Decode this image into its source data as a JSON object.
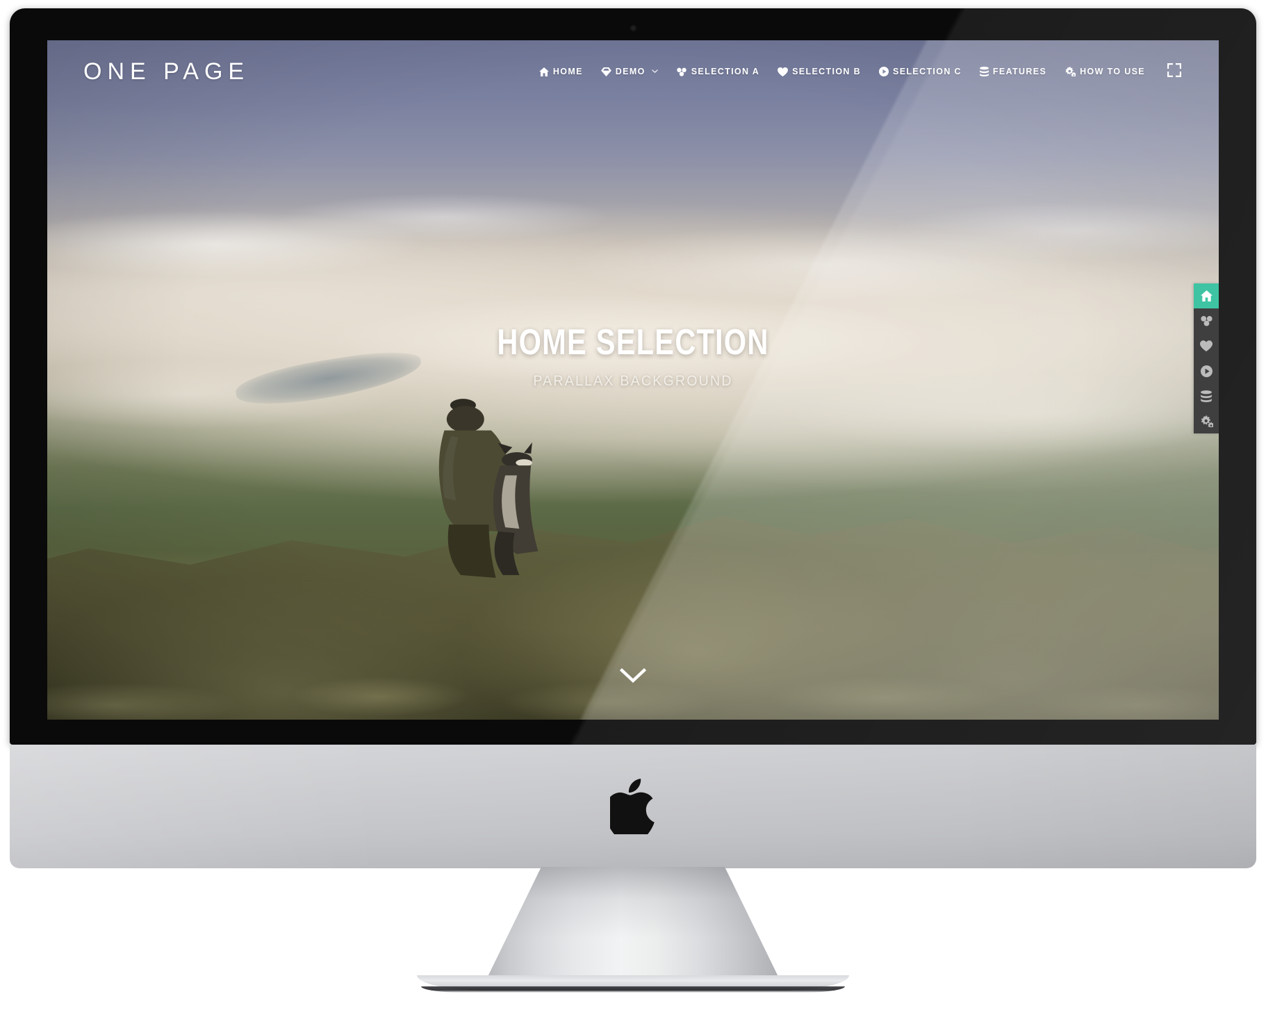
{
  "device": {
    "brand_logo_name": "apple-logo",
    "type": "imac-desktop-mockup"
  },
  "site": {
    "brand": "ONE PAGE",
    "nav": [
      {
        "label": "HOME",
        "icon": "home-icon",
        "has_caret": false
      },
      {
        "label": "DEMO",
        "icon": "gem-icon",
        "has_caret": true
      },
      {
        "label": "SELECTION A",
        "icon": "cubes-icon",
        "has_caret": false
      },
      {
        "label": "SELECTION B",
        "icon": "heart-icon",
        "has_caret": false
      },
      {
        "label": "SELECTION C",
        "icon": "play-circle-icon",
        "has_caret": false
      },
      {
        "label": "FEATURES",
        "icon": "database-icon",
        "has_caret": false
      },
      {
        "label": "HOW TO USE",
        "icon": "gears-icon",
        "has_caret": false
      }
    ],
    "nav_expand_icon": "expand-fullscreen-icon",
    "hero": {
      "title": "HOME SELECTION",
      "subtitle": "PARALLAX BACKGROUND",
      "scroll_hint_icon": "chevron-down-icon"
    },
    "side_dock": {
      "active_index": 0,
      "accent_color": "#2bbe9a",
      "background_color": "#2b2b2b",
      "items": [
        {
          "icon": "home-icon",
          "active": true
        },
        {
          "icon": "cubes-icon",
          "active": false
        },
        {
          "icon": "heart-icon",
          "active": false
        },
        {
          "icon": "play-circle-icon",
          "active": false
        },
        {
          "icon": "database-icon",
          "active": false
        },
        {
          "icon": "gears-icon",
          "active": false
        }
      ]
    }
  }
}
